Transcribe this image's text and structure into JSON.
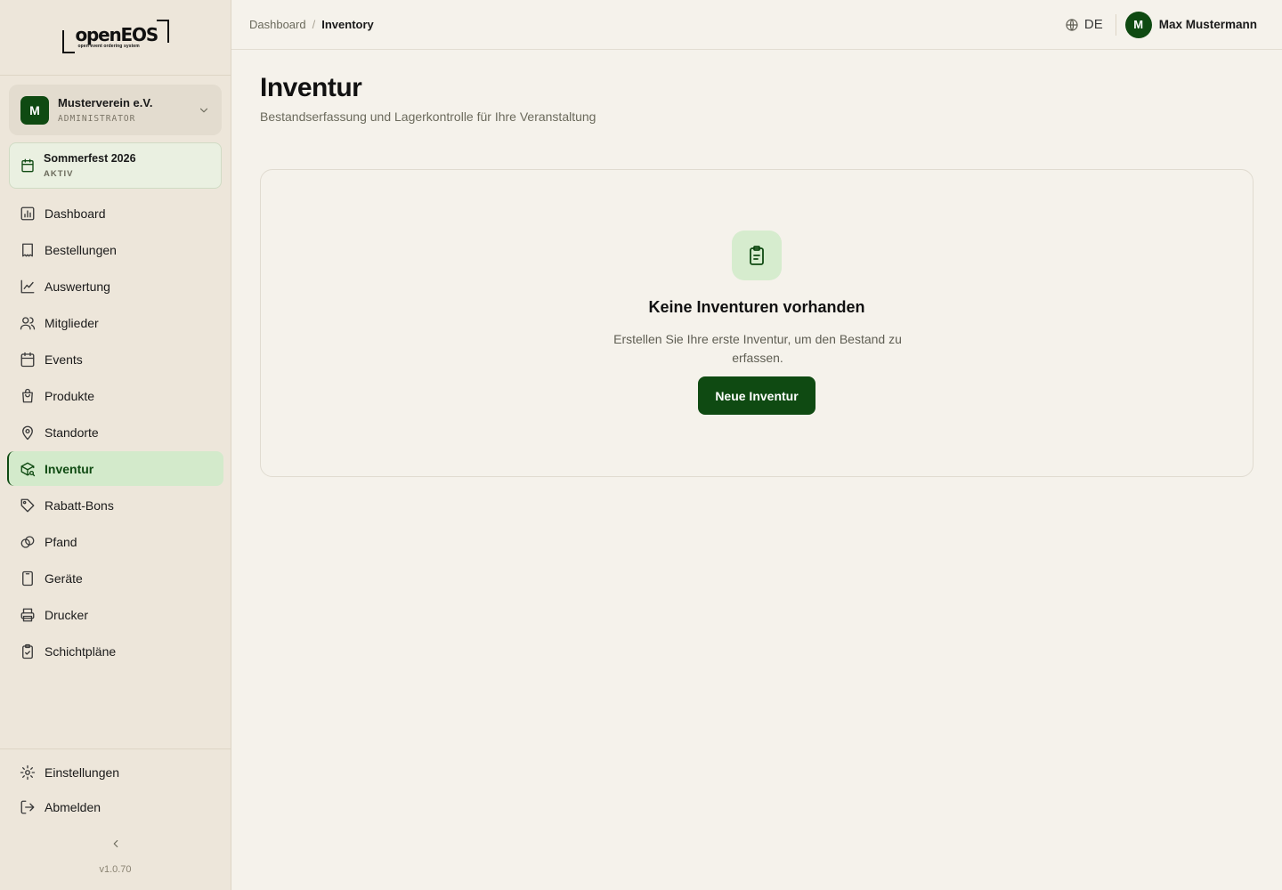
{
  "logo": {
    "word": "openEOS",
    "tagline": "open event ordering system"
  },
  "org": {
    "avatar": "M",
    "name": "Musterverein e.V.",
    "role": "ADMINISTRATOR"
  },
  "event": {
    "name": "Sommerfest 2026",
    "status": "AKTIV"
  },
  "nav": {
    "items": [
      {
        "label": "Dashboard",
        "icon": "bar-chart-icon"
      },
      {
        "label": "Bestellungen",
        "icon": "receipt-icon"
      },
      {
        "label": "Auswertung",
        "icon": "line-chart-icon"
      },
      {
        "label": "Mitglieder",
        "icon": "users-icon"
      },
      {
        "label": "Events",
        "icon": "calendar-icon"
      },
      {
        "label": "Produkte",
        "icon": "shopping-bag-icon"
      },
      {
        "label": "Standorte",
        "icon": "map-pin-icon"
      },
      {
        "label": "Inventur",
        "icon": "package-search-icon",
        "active": true
      },
      {
        "label": "Rabatt-Bons",
        "icon": "tag-icon"
      },
      {
        "label": "Pfand",
        "icon": "link-icon"
      },
      {
        "label": "Geräte",
        "icon": "tablet-icon"
      },
      {
        "label": "Drucker",
        "icon": "printer-icon"
      },
      {
        "label": "Schichtpläne",
        "icon": "clipboard-check-icon"
      }
    ],
    "bottom": [
      {
        "label": "Einstellungen",
        "icon": "gear-icon"
      },
      {
        "label": "Abmelden",
        "icon": "logout-icon"
      }
    ]
  },
  "version": "v1.0.70",
  "breadcrumb": {
    "root": "Dashboard",
    "separator": "/",
    "current": "Inventory"
  },
  "header": {
    "language": "DE",
    "user_avatar": "M",
    "user_name": "Max Mustermann"
  },
  "page": {
    "title": "Inventur",
    "subtitle": "Bestandserfassung und Lagerkontrolle für Ihre Veranstaltung"
  },
  "empty_state": {
    "title": "Keine Inventuren vorhanden",
    "text": "Erstellen Sie Ihre erste Inventur, um den Bestand zu erfassen.",
    "button_label": "Neue Inventur"
  },
  "colors": {
    "accent": "#0f4a12",
    "active_bg": "#d3eacb",
    "sidebar_bg": "#ede6da",
    "page_bg": "#f5f2eb"
  }
}
